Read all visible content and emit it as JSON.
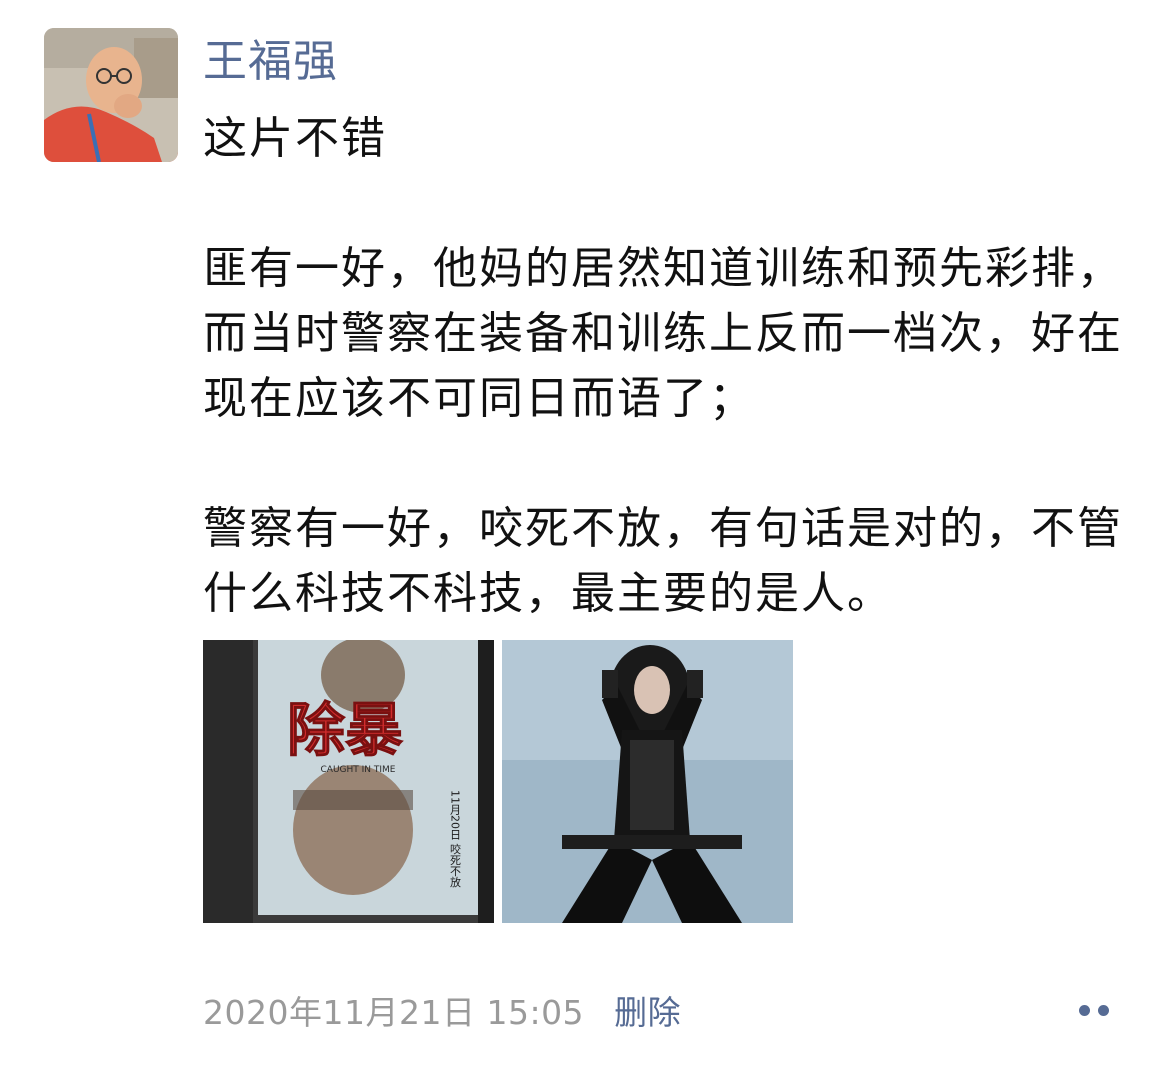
{
  "post": {
    "author": "王福强",
    "paragraphs": [
      "这片不错",
      "",
      "匪有一好，他妈的居然知道训练和预先彩排，而当时警察在装备和训练上反而一档次，好在现在应该不可同日而语了；",
      "",
      "警察有一好，咬死不放，有句话是对的，不管什么科技不科技，最主要的是人。"
    ],
    "photos": [
      {
        "title_text": "除暴",
        "subtitle_text": "CAUGHT IN TIME",
        "side_text": "11月20日 咬死不放"
      },
      {}
    ],
    "timestamp": "2020年11月21日 15:05",
    "delete_label": "删除"
  },
  "colors": {
    "author": "#566b94",
    "text": "#111111",
    "meta": "#9a9a9a",
    "link": "#566b94"
  },
  "icons": {
    "more": "more-dots-icon"
  }
}
